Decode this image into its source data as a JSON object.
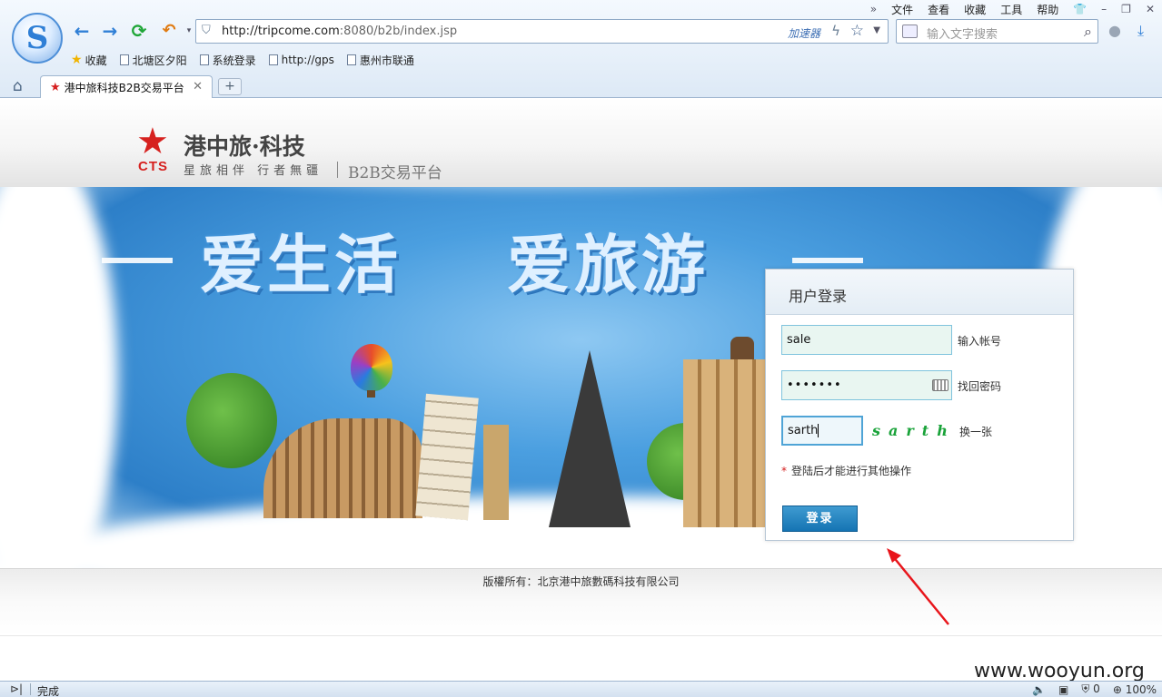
{
  "browser": {
    "menu": [
      "文件",
      "查看",
      "收藏",
      "工具",
      "帮助"
    ],
    "url_host": "http://tripcome.com",
    "url_rest": ":8080/b2b/index.jsp",
    "accelerator": "加速器",
    "search_placeholder": "输入文字搜索",
    "favorites": [
      "收藏",
      "北塘区夕阳",
      "系统登录",
      "http://gps",
      "惠州市联通"
    ],
    "tab_title": "港中旅科技B2B交易平台",
    "status": "完成",
    "zoom": "100%",
    "shield_count": "0"
  },
  "site": {
    "brand_mark": "CTS",
    "brand_name": "港中旅·科技",
    "brand_slogan": "星旅相伴 行者無疆",
    "platform": "B2B交易平台",
    "banner_slogan_1": "爱生活",
    "banner_slogan_2": "爱旅游",
    "copyright": "版權所有：北京港中旅數碼科技有限公司"
  },
  "login": {
    "title": "用户登录",
    "username": "sale",
    "password_mask": "•••••••",
    "captcha_input": "sarth",
    "captcha_image_text": "sarth",
    "label_account": "输入帐号",
    "link_forgot": "找回密码",
    "link_refresh": "换一张",
    "note": "登陆后才能进行其他操作",
    "required_mark": "*",
    "submit": "登录"
  },
  "watermark": "www.wooyun.org",
  "colors": {
    "accent_red": "#d6211f",
    "login_button": "#1574b3",
    "captcha_green": "#1aa33a",
    "annotation_arrow": "#e8151b"
  }
}
